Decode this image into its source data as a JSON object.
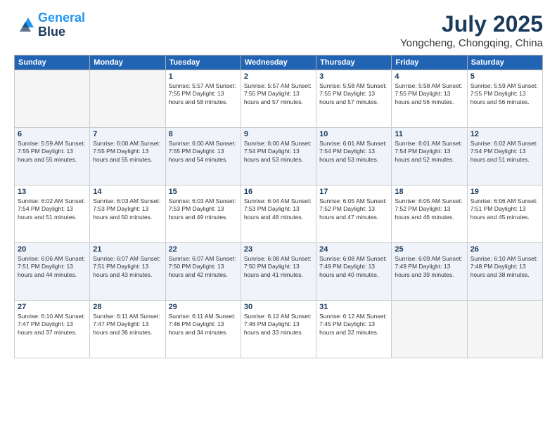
{
  "logo": {
    "line1": "General",
    "line2": "Blue"
  },
  "title": "July 2025",
  "location": "Yongcheng, Chongqing, China",
  "weekdays": [
    "Sunday",
    "Monday",
    "Tuesday",
    "Wednesday",
    "Thursday",
    "Friday",
    "Saturday"
  ],
  "weeks": [
    [
      {
        "day": "",
        "text": ""
      },
      {
        "day": "",
        "text": ""
      },
      {
        "day": "1",
        "text": "Sunrise: 5:57 AM\nSunset: 7:55 PM\nDaylight: 13 hours and 58 minutes."
      },
      {
        "day": "2",
        "text": "Sunrise: 5:57 AM\nSunset: 7:55 PM\nDaylight: 13 hours and 57 minutes."
      },
      {
        "day": "3",
        "text": "Sunrise: 5:58 AM\nSunset: 7:55 PM\nDaylight: 13 hours and 57 minutes."
      },
      {
        "day": "4",
        "text": "Sunrise: 5:58 AM\nSunset: 7:55 PM\nDaylight: 13 hours and 56 minutes."
      },
      {
        "day": "5",
        "text": "Sunrise: 5:59 AM\nSunset: 7:55 PM\nDaylight: 13 hours and 56 minutes."
      }
    ],
    [
      {
        "day": "6",
        "text": "Sunrise: 5:59 AM\nSunset: 7:55 PM\nDaylight: 13 hours and 55 minutes."
      },
      {
        "day": "7",
        "text": "Sunrise: 6:00 AM\nSunset: 7:55 PM\nDaylight: 13 hours and 55 minutes."
      },
      {
        "day": "8",
        "text": "Sunrise: 6:00 AM\nSunset: 7:55 PM\nDaylight: 13 hours and 54 minutes."
      },
      {
        "day": "9",
        "text": "Sunrise: 6:00 AM\nSunset: 7:54 PM\nDaylight: 13 hours and 53 minutes."
      },
      {
        "day": "10",
        "text": "Sunrise: 6:01 AM\nSunset: 7:54 PM\nDaylight: 13 hours and 53 minutes."
      },
      {
        "day": "11",
        "text": "Sunrise: 6:01 AM\nSunset: 7:54 PM\nDaylight: 13 hours and 52 minutes."
      },
      {
        "day": "12",
        "text": "Sunrise: 6:02 AM\nSunset: 7:54 PM\nDaylight: 13 hours and 51 minutes."
      }
    ],
    [
      {
        "day": "13",
        "text": "Sunrise: 6:02 AM\nSunset: 7:54 PM\nDaylight: 13 hours and 51 minutes."
      },
      {
        "day": "14",
        "text": "Sunrise: 6:03 AM\nSunset: 7:53 PM\nDaylight: 13 hours and 50 minutes."
      },
      {
        "day": "15",
        "text": "Sunrise: 6:03 AM\nSunset: 7:53 PM\nDaylight: 13 hours and 49 minutes."
      },
      {
        "day": "16",
        "text": "Sunrise: 6:04 AM\nSunset: 7:53 PM\nDaylight: 13 hours and 48 minutes."
      },
      {
        "day": "17",
        "text": "Sunrise: 6:05 AM\nSunset: 7:52 PM\nDaylight: 13 hours and 47 minutes."
      },
      {
        "day": "18",
        "text": "Sunrise: 6:05 AM\nSunset: 7:52 PM\nDaylight: 13 hours and 46 minutes."
      },
      {
        "day": "19",
        "text": "Sunrise: 6:06 AM\nSunset: 7:51 PM\nDaylight: 13 hours and 45 minutes."
      }
    ],
    [
      {
        "day": "20",
        "text": "Sunrise: 6:06 AM\nSunset: 7:51 PM\nDaylight: 13 hours and 44 minutes."
      },
      {
        "day": "21",
        "text": "Sunrise: 6:07 AM\nSunset: 7:51 PM\nDaylight: 13 hours and 43 minutes."
      },
      {
        "day": "22",
        "text": "Sunrise: 6:07 AM\nSunset: 7:50 PM\nDaylight: 13 hours and 42 minutes."
      },
      {
        "day": "23",
        "text": "Sunrise: 6:08 AM\nSunset: 7:50 PM\nDaylight: 13 hours and 41 minutes."
      },
      {
        "day": "24",
        "text": "Sunrise: 6:08 AM\nSunset: 7:49 PM\nDaylight: 13 hours and 40 minutes."
      },
      {
        "day": "25",
        "text": "Sunrise: 6:09 AM\nSunset: 7:49 PM\nDaylight: 13 hours and 39 minutes."
      },
      {
        "day": "26",
        "text": "Sunrise: 6:10 AM\nSunset: 7:48 PM\nDaylight: 13 hours and 38 minutes."
      }
    ],
    [
      {
        "day": "27",
        "text": "Sunrise: 6:10 AM\nSunset: 7:47 PM\nDaylight: 13 hours and 37 minutes."
      },
      {
        "day": "28",
        "text": "Sunrise: 6:11 AM\nSunset: 7:47 PM\nDaylight: 13 hours and 36 minutes."
      },
      {
        "day": "29",
        "text": "Sunrise: 6:11 AM\nSunset: 7:46 PM\nDaylight: 13 hours and 34 minutes."
      },
      {
        "day": "30",
        "text": "Sunrise: 6:12 AM\nSunset: 7:46 PM\nDaylight: 13 hours and 33 minutes."
      },
      {
        "day": "31",
        "text": "Sunrise: 6:12 AM\nSunset: 7:45 PM\nDaylight: 13 hours and 32 minutes."
      },
      {
        "day": "",
        "text": ""
      },
      {
        "day": "",
        "text": ""
      }
    ]
  ]
}
